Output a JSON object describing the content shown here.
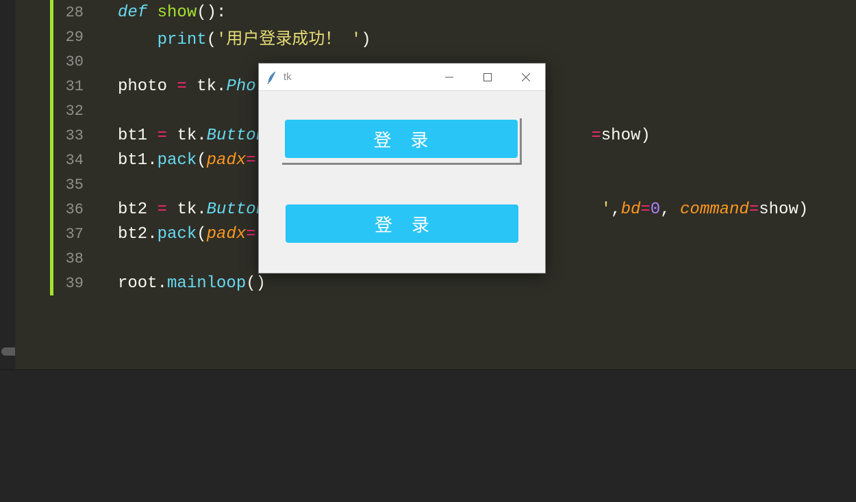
{
  "editor": {
    "lines": [
      {
        "no": "28",
        "html": "<span class='kw'>def</span> <span class='fn'>show</span><span class='punc'>():</span>"
      },
      {
        "no": "29",
        "html": "    <span class='call'>print</span><span class='punc'>(</span><span class='str'>'用户登录成功！ '</span><span class='punc'>)</span>"
      },
      {
        "no": "30",
        "html": ""
      },
      {
        "no": "31",
        "html": "<span class='var'>photo</span> <span class='eq'>=</span> <span class='var'>tk</span><span class='punc'>.</span><span class='cls'>Phot</span>"
      },
      {
        "no": "32",
        "html": ""
      },
      {
        "no": "33",
        "html": "<span class='var'>bt1</span> <span class='eq'>=</span> <span class='var'>tk</span><span class='punc'>.</span><span class='cls'>Button</span>                                 <span class='eq'>=</span><span class='var'>show</span><span class='punc'>)</span>"
      },
      {
        "no": "34",
        "html": "<span class='var'>bt1</span><span class='punc'>.</span><span class='method'>pack</span><span class='punc'>(</span><span class='param'>padx</span><span class='eq'>=</span>"
      },
      {
        "no": "35",
        "html": ""
      },
      {
        "no": "36",
        "html": "<span class='var'>bt2</span> <span class='eq'>=</span> <span class='var'>tk</span><span class='punc'>.</span><span class='cls'>Button</span>                                  <span class='str'>'</span><span class='punc'>,</span><span class='param'>bd</span><span class='eq'>=</span><span class='num'>0</span><span class='punc'>,</span> <span class='param'>command</span><span class='eq'>=</span><span class='var'>show</span><span class='punc'>)</span>"
      },
      {
        "no": "37",
        "html": "<span class='var'>bt2</span><span class='punc'>.</span><span class='method'>pack</span><span class='punc'>(</span><span class='param'>padx</span><span class='eq'>=</span>"
      },
      {
        "no": "38",
        "html": ""
      },
      {
        "no": "39",
        "html": "<span class='var'>root</span><span class='punc'>.</span><span class='method'>mainloop</span><span class='punc'>()</span>"
      }
    ]
  },
  "tk": {
    "title": "tk",
    "button1": "登录",
    "button2": "登录"
  }
}
